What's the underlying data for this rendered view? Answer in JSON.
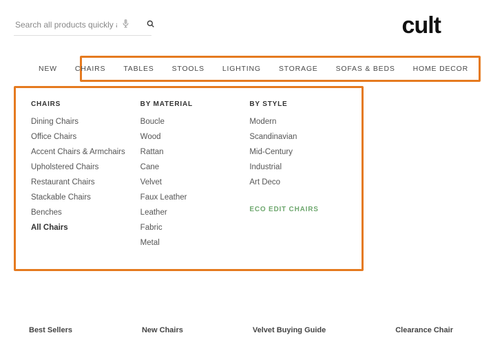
{
  "search": {
    "placeholder": "Search all products quickly and ea"
  },
  "logo": "cult",
  "nav": [
    "NEW",
    "CHAIRS",
    "TABLES",
    "STOOLS",
    "LIGHTING",
    "STORAGE",
    "SOFAS & BEDS",
    "HOME DECOR"
  ],
  "mega": {
    "col0": {
      "head": "CHAIRS",
      "items": [
        "Dining Chairs",
        "Office Chairs",
        "Accent Chairs & Armchairs",
        "Upholstered Chairs",
        "Restaurant Chairs",
        "Stackable Chairs",
        "Benches",
        "All Chairs"
      ]
    },
    "col1": {
      "head": "BY MATERIAL",
      "items": [
        "Boucle",
        "Wood",
        "Rattan",
        "Cane",
        "Velvet",
        "Faux Leather",
        "Leather",
        "Fabric",
        "Metal"
      ]
    },
    "col2": {
      "head": "BY STYLE",
      "items": [
        "Modern",
        "Scandinavian",
        "Mid-Century",
        "Industrial",
        "Art Deco"
      ],
      "eco": "ECO EDIT CHAIRS"
    }
  },
  "footer": [
    "Best Sellers",
    "New Chairs",
    "Velvet Buying Guide",
    "Clearance Chair"
  ]
}
